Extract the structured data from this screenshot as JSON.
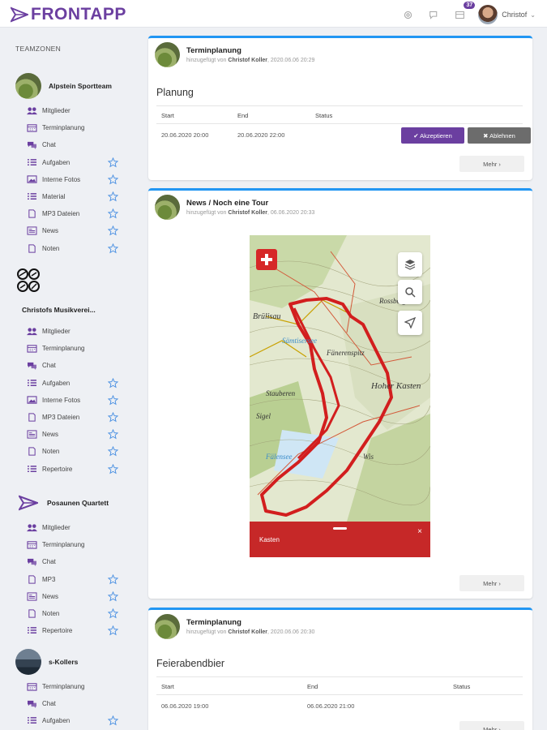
{
  "app": {
    "brand": "FRONTAPP"
  },
  "topbar": {
    "notification_count": "37",
    "user_name": "Christof"
  },
  "sidebar": {
    "heading": "TEAMZONEN",
    "teams": [
      {
        "name": "Alpstein Sportteam",
        "items": [
          "Mitglieder",
          "Terminplanung",
          "Chat",
          "Aufgaben",
          "Interne Fotos",
          "Material",
          "MP3 Dateien",
          "News",
          "Noten"
        ]
      },
      {
        "name": "Christofs Musikverei...",
        "items": [
          "Mitglieder",
          "Terminplanung",
          "Chat",
          "Aufgaben",
          "Interne Fotos",
          "MP3 Dateien",
          "News",
          "Noten",
          "Repertoire"
        ]
      },
      {
        "name": "Posaunen Quartett",
        "items": [
          "Mitglieder",
          "Terminplanung",
          "Chat",
          "MP3",
          "News",
          "Noten",
          "Repertoire"
        ]
      },
      {
        "name": "s-Kollers",
        "items": [
          "Terminplanung",
          "Chat",
          "Aufgaben"
        ]
      }
    ]
  },
  "feed": {
    "card1": {
      "title": "Terminplanung",
      "added_prefix": "hinzugefügt von",
      "author": "Christof Koller",
      "timestamp": "2020.06.06 20:29",
      "section": "Planung",
      "columns": [
        "Start",
        "End",
        "Status"
      ],
      "row": {
        "start": "20.06.2020 20:00",
        "end": "20.06.2020 22:00"
      },
      "accept_label": "✔ Akzeptieren",
      "decline_label": "✖ Ablehnen",
      "more_label": "Mehr ›"
    },
    "card2": {
      "title": "News / Noch eine Tour",
      "added_prefix": "hinzugefügt von",
      "author": "Christof Koller",
      "timestamp": "06.06.2020 20:33",
      "map": {
        "panel_label": "Kasten",
        "close_symbol": "×",
        "place_labels": [
          "Rossberg",
          "Brülisau",
          "Sämtisersee",
          "Fänerenspitz",
          "Hoher Kasten",
          "Stauberen",
          "Sigel",
          "Fälensee",
          "Wis"
        ]
      },
      "more_label": "Mehr ›"
    },
    "card3": {
      "title": "Terminplanung",
      "added_prefix": "hinzugefügt von",
      "author": "Christof Koller",
      "timestamp": "2020.06.06 20:30",
      "section": "Feierabendbier",
      "columns": [
        "Start",
        "End",
        "Status"
      ],
      "row": {
        "start": "06.06.2020 19:00",
        "end": "06.06.2020 21:00"
      },
      "more_label": "Mehr ›"
    }
  },
  "colors": {
    "brand": "#6b3fa0",
    "card_border": "#2196f3",
    "menu_icon": "#6b3fa0",
    "star": "#4a90e2",
    "map_red": "#c62828"
  }
}
